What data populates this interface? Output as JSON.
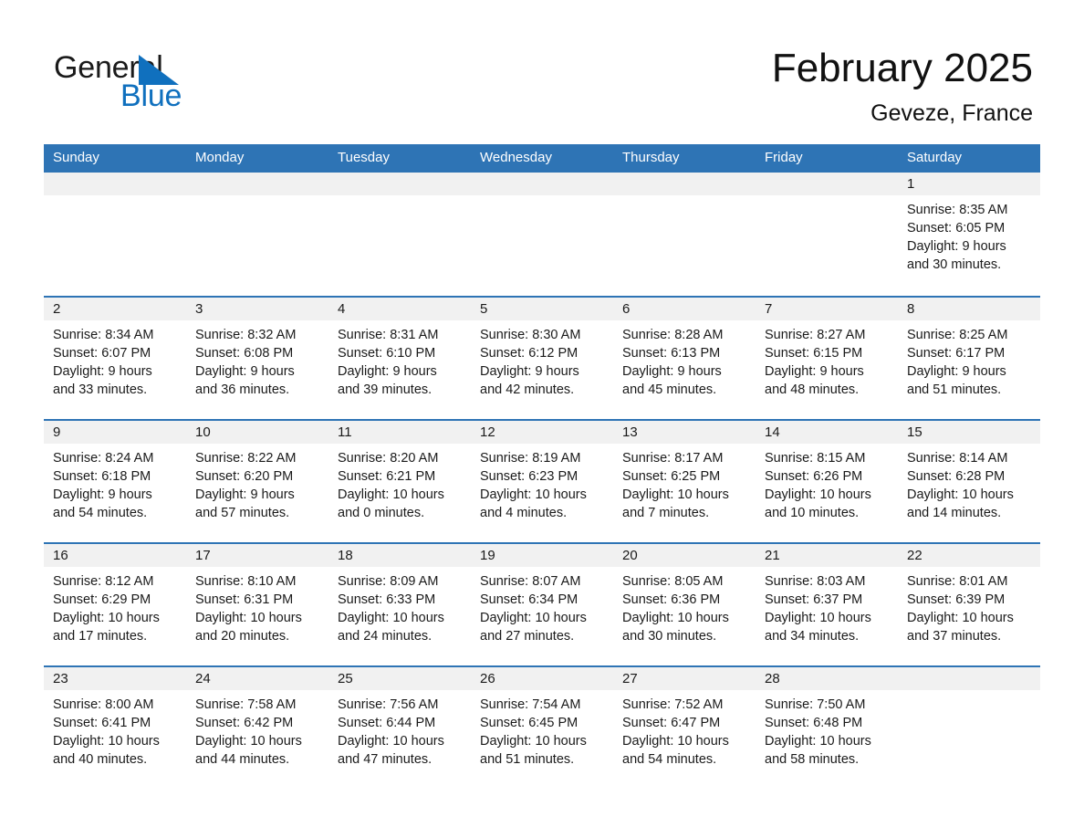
{
  "brand": {
    "word_one": "General",
    "word_two": "Blue",
    "triangle_color": "#1070BE",
    "blue_text_color": "#1070BE"
  },
  "header": {
    "title": "February 2025",
    "location": "Geveze, France"
  },
  "theme": {
    "header_blue": "#2E74B5",
    "daynum_band": "#F1F1F1",
    "text": "#1a1a1a",
    "page_background": "#ffffff"
  },
  "weekday_headers": [
    "Sunday",
    "Monday",
    "Tuesday",
    "Wednesday",
    "Thursday",
    "Friday",
    "Saturday"
  ],
  "weeks": [
    [
      {
        "day": "",
        "sunrise": "",
        "sunset": "",
        "daylight_line1": "",
        "daylight_line2": "",
        "empty": true
      },
      {
        "day": "",
        "sunrise": "",
        "sunset": "",
        "daylight_line1": "",
        "daylight_line2": "",
        "empty": true
      },
      {
        "day": "",
        "sunrise": "",
        "sunset": "",
        "daylight_line1": "",
        "daylight_line2": "",
        "empty": true
      },
      {
        "day": "",
        "sunrise": "",
        "sunset": "",
        "daylight_line1": "",
        "daylight_line2": "",
        "empty": true
      },
      {
        "day": "",
        "sunrise": "",
        "sunset": "",
        "daylight_line1": "",
        "daylight_line2": "",
        "empty": true
      },
      {
        "day": "",
        "sunrise": "",
        "sunset": "",
        "daylight_line1": "",
        "daylight_line2": "",
        "empty": true
      },
      {
        "day": "1",
        "sunrise": "Sunrise: 8:35 AM",
        "sunset": "Sunset: 6:05 PM",
        "daylight_line1": "Daylight: 9 hours",
        "daylight_line2": "and 30 minutes."
      }
    ],
    [
      {
        "day": "2",
        "sunrise": "Sunrise: 8:34 AM",
        "sunset": "Sunset: 6:07 PM",
        "daylight_line1": "Daylight: 9 hours",
        "daylight_line2": "and 33 minutes."
      },
      {
        "day": "3",
        "sunrise": "Sunrise: 8:32 AM",
        "sunset": "Sunset: 6:08 PM",
        "daylight_line1": "Daylight: 9 hours",
        "daylight_line2": "and 36 minutes."
      },
      {
        "day": "4",
        "sunrise": "Sunrise: 8:31 AM",
        "sunset": "Sunset: 6:10 PM",
        "daylight_line1": "Daylight: 9 hours",
        "daylight_line2": "and 39 minutes."
      },
      {
        "day": "5",
        "sunrise": "Sunrise: 8:30 AM",
        "sunset": "Sunset: 6:12 PM",
        "daylight_line1": "Daylight: 9 hours",
        "daylight_line2": "and 42 minutes."
      },
      {
        "day": "6",
        "sunrise": "Sunrise: 8:28 AM",
        "sunset": "Sunset: 6:13 PM",
        "daylight_line1": "Daylight: 9 hours",
        "daylight_line2": "and 45 minutes."
      },
      {
        "day": "7",
        "sunrise": "Sunrise: 8:27 AM",
        "sunset": "Sunset: 6:15 PM",
        "daylight_line1": "Daylight: 9 hours",
        "daylight_line2": "and 48 minutes."
      },
      {
        "day": "8",
        "sunrise": "Sunrise: 8:25 AM",
        "sunset": "Sunset: 6:17 PM",
        "daylight_line1": "Daylight: 9 hours",
        "daylight_line2": "and 51 minutes."
      }
    ],
    [
      {
        "day": "9",
        "sunrise": "Sunrise: 8:24 AM",
        "sunset": "Sunset: 6:18 PM",
        "daylight_line1": "Daylight: 9 hours",
        "daylight_line2": "and 54 minutes."
      },
      {
        "day": "10",
        "sunrise": "Sunrise: 8:22 AM",
        "sunset": "Sunset: 6:20 PM",
        "daylight_line1": "Daylight: 9 hours",
        "daylight_line2": "and 57 minutes."
      },
      {
        "day": "11",
        "sunrise": "Sunrise: 8:20 AM",
        "sunset": "Sunset: 6:21 PM",
        "daylight_line1": "Daylight: 10 hours",
        "daylight_line2": "and 0 minutes."
      },
      {
        "day": "12",
        "sunrise": "Sunrise: 8:19 AM",
        "sunset": "Sunset: 6:23 PM",
        "daylight_line1": "Daylight: 10 hours",
        "daylight_line2": "and 4 minutes."
      },
      {
        "day": "13",
        "sunrise": "Sunrise: 8:17 AM",
        "sunset": "Sunset: 6:25 PM",
        "daylight_line1": "Daylight: 10 hours",
        "daylight_line2": "and 7 minutes."
      },
      {
        "day": "14",
        "sunrise": "Sunrise: 8:15 AM",
        "sunset": "Sunset: 6:26 PM",
        "daylight_line1": "Daylight: 10 hours",
        "daylight_line2": "and 10 minutes."
      },
      {
        "day": "15",
        "sunrise": "Sunrise: 8:14 AM",
        "sunset": "Sunset: 6:28 PM",
        "daylight_line1": "Daylight: 10 hours",
        "daylight_line2": "and 14 minutes."
      }
    ],
    [
      {
        "day": "16",
        "sunrise": "Sunrise: 8:12 AM",
        "sunset": "Sunset: 6:29 PM",
        "daylight_line1": "Daylight: 10 hours",
        "daylight_line2": "and 17 minutes."
      },
      {
        "day": "17",
        "sunrise": "Sunrise: 8:10 AM",
        "sunset": "Sunset: 6:31 PM",
        "daylight_line1": "Daylight: 10 hours",
        "daylight_line2": "and 20 minutes."
      },
      {
        "day": "18",
        "sunrise": "Sunrise: 8:09 AM",
        "sunset": "Sunset: 6:33 PM",
        "daylight_line1": "Daylight: 10 hours",
        "daylight_line2": "and 24 minutes."
      },
      {
        "day": "19",
        "sunrise": "Sunrise: 8:07 AM",
        "sunset": "Sunset: 6:34 PM",
        "daylight_line1": "Daylight: 10 hours",
        "daylight_line2": "and 27 minutes."
      },
      {
        "day": "20",
        "sunrise": "Sunrise: 8:05 AM",
        "sunset": "Sunset: 6:36 PM",
        "daylight_line1": "Daylight: 10 hours",
        "daylight_line2": "and 30 minutes."
      },
      {
        "day": "21",
        "sunrise": "Sunrise: 8:03 AM",
        "sunset": "Sunset: 6:37 PM",
        "daylight_line1": "Daylight: 10 hours",
        "daylight_line2": "and 34 minutes."
      },
      {
        "day": "22",
        "sunrise": "Sunrise: 8:01 AM",
        "sunset": "Sunset: 6:39 PM",
        "daylight_line1": "Daylight: 10 hours",
        "daylight_line2": "and 37 minutes."
      }
    ],
    [
      {
        "day": "23",
        "sunrise": "Sunrise: 8:00 AM",
        "sunset": "Sunset: 6:41 PM",
        "daylight_line1": "Daylight: 10 hours",
        "daylight_line2": "and 40 minutes."
      },
      {
        "day": "24",
        "sunrise": "Sunrise: 7:58 AM",
        "sunset": "Sunset: 6:42 PM",
        "daylight_line1": "Daylight: 10 hours",
        "daylight_line2": "and 44 minutes."
      },
      {
        "day": "25",
        "sunrise": "Sunrise: 7:56 AM",
        "sunset": "Sunset: 6:44 PM",
        "daylight_line1": "Daylight: 10 hours",
        "daylight_line2": "and 47 minutes."
      },
      {
        "day": "26",
        "sunrise": "Sunrise: 7:54 AM",
        "sunset": "Sunset: 6:45 PM",
        "daylight_line1": "Daylight: 10 hours",
        "daylight_line2": "and 51 minutes."
      },
      {
        "day": "27",
        "sunrise": "Sunrise: 7:52 AM",
        "sunset": "Sunset: 6:47 PM",
        "daylight_line1": "Daylight: 10 hours",
        "daylight_line2": "and 54 minutes."
      },
      {
        "day": "28",
        "sunrise": "Sunrise: 7:50 AM",
        "sunset": "Sunset: 6:48 PM",
        "daylight_line1": "Daylight: 10 hours",
        "daylight_line2": "and 58 minutes."
      },
      {
        "day": "",
        "sunrise": "",
        "sunset": "",
        "daylight_line1": "",
        "daylight_line2": "",
        "empty": true
      }
    ]
  ]
}
